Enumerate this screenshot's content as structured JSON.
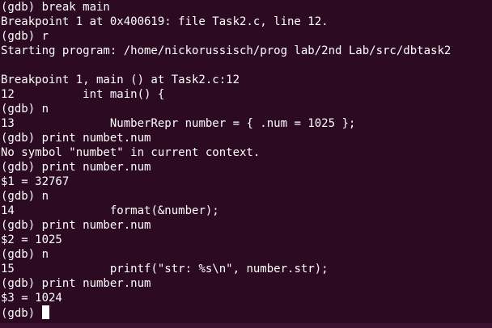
{
  "terminal": {
    "lines": [
      "(gdb) break main",
      "Breakpoint 1 at 0x400619: file Task2.c, line 12.",
      "(gdb) r",
      "Starting program: /home/nickorussisch/prog lab/2nd Lab/src/dbtask2",
      "",
      "Breakpoint 1, main () at Task2.c:12",
      "12\t    int main() {",
      "(gdb) n",
      "13\t        NumberRepr number = { .num = 1025 };",
      "(gdb) print numbet.num",
      "No symbol \"numbet\" in current context.",
      "(gdb) print number.num",
      "$1 = 32767",
      "(gdb) n",
      "14\t        format(&number);",
      "(gdb) print number.num",
      "$2 = 1025",
      "(gdb) n",
      "15\t        printf(\"str: %s\\n\", number.str);",
      "(gdb) print number.num",
      "$3 = 1024"
    ],
    "prompt": "(gdb) "
  },
  "colors": {
    "background": "#2c0a22",
    "foreground": "#ffffff"
  }
}
